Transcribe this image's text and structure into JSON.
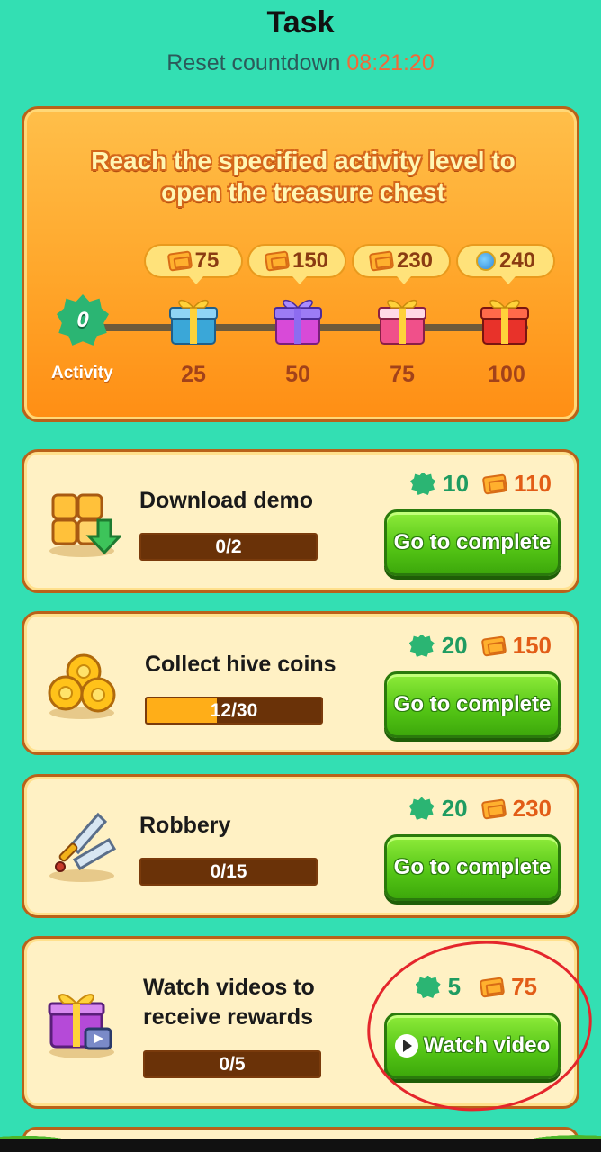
{
  "header": {
    "title": "Task",
    "countdown_label": "Reset countdown",
    "countdown_time": "08:21:20"
  },
  "chest_panel": {
    "heading": "Reach the specified activity level to open the treasure chest",
    "activity_value": "0",
    "activity_label": "Activity",
    "activity_progress": 0,
    "chests": [
      {
        "reward": "75",
        "reward_icon": "ticket-icon",
        "level": "25",
        "color": "#3aa7d8"
      },
      {
        "reward": "150",
        "reward_icon": "ticket-icon",
        "level": "50",
        "color": "#c84ad8"
      },
      {
        "reward": "230",
        "reward_icon": "ticket-icon",
        "level": "75",
        "color": "#f0508a"
      },
      {
        "reward": "240",
        "reward_icon": "pot-icon",
        "level": "100",
        "color": "#e8322a"
      }
    ]
  },
  "tasks": [
    {
      "name": "Download demo",
      "progress_text": "0/2",
      "progress": 0,
      "activity_reward": "10",
      "ticket_reward": "110",
      "button": "Go to complete",
      "icon": "download-icon"
    },
    {
      "name": "Collect hive coins",
      "progress_text": "12/30",
      "progress": 0.4,
      "activity_reward": "20",
      "ticket_reward": "150",
      "button": "Go to complete",
      "icon": "coins-icon"
    },
    {
      "name": "Robbery",
      "progress_text": "0/15",
      "progress": 0,
      "activity_reward": "20",
      "ticket_reward": "230",
      "button": "Go to complete",
      "icon": "swords-icon"
    },
    {
      "name": "Watch videos to receive rewards",
      "progress_text": "0/5",
      "progress": 0,
      "activity_reward": "5",
      "ticket_reward": "75",
      "button": "Watch video",
      "icon": "gift-video-icon"
    }
  ],
  "colors": {
    "background": "#33dfb3",
    "accent_orange": "#ffa62a",
    "button_green": "#53c415",
    "annotation_red": "#e4262c"
  }
}
